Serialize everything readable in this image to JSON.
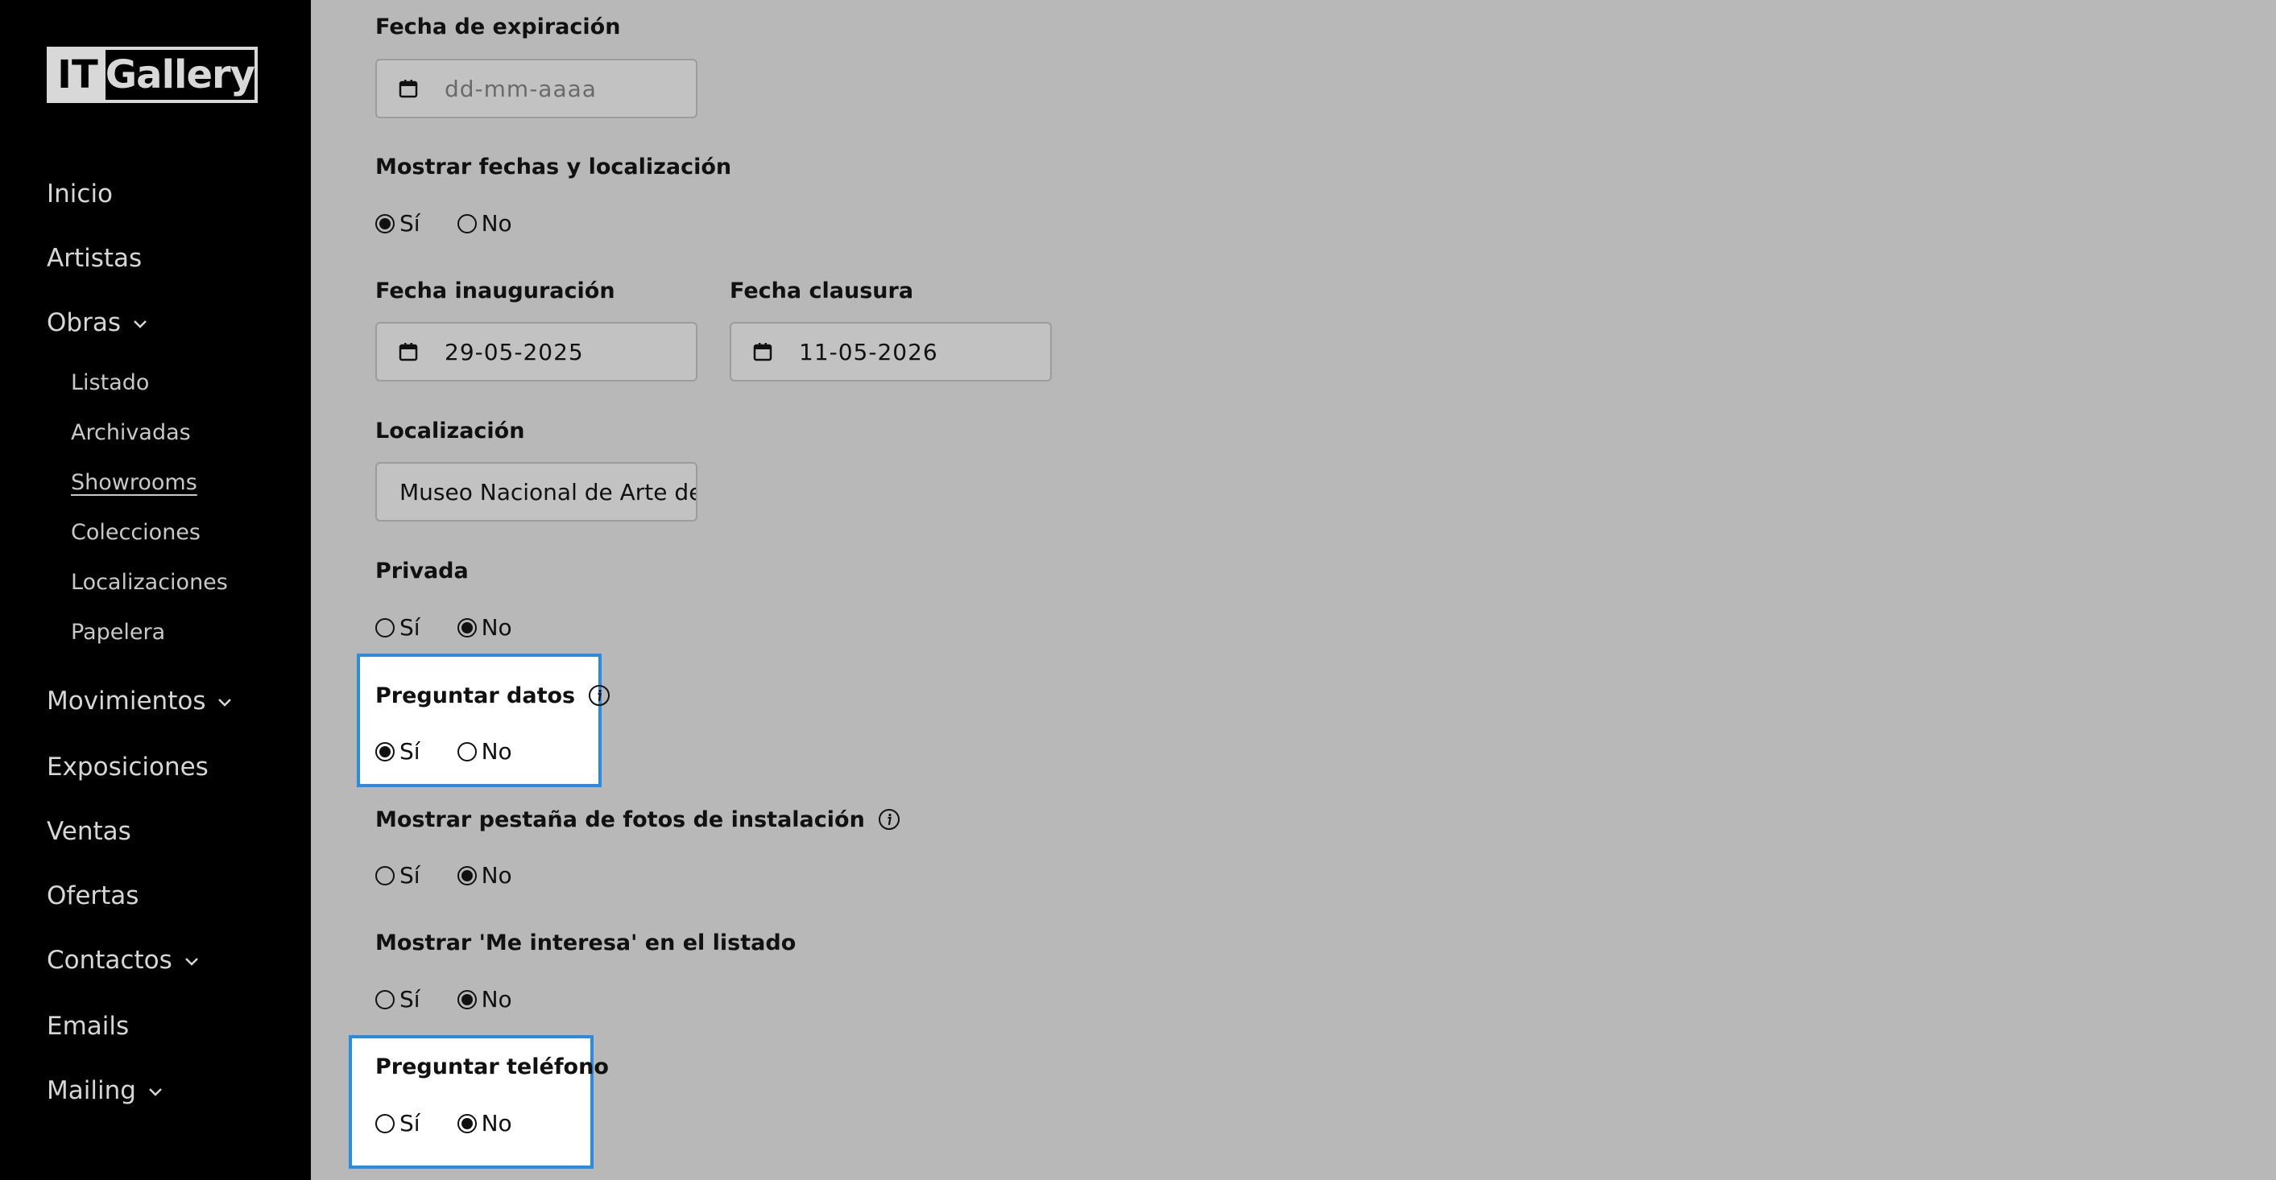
{
  "sidebar": {
    "logo": {
      "it": "IT",
      "gallery": "Gallery"
    },
    "items": [
      {
        "label": "Inicio"
      },
      {
        "label": "Artistas"
      },
      {
        "label": "Obras"
      },
      {
        "label": "Movimientos"
      },
      {
        "label": "Exposiciones"
      },
      {
        "label": "Ventas"
      },
      {
        "label": "Ofertas"
      },
      {
        "label": "Contactos"
      },
      {
        "label": "Emails"
      },
      {
        "label": "Mailing"
      }
    ],
    "obras_sub": [
      {
        "label": "Listado"
      },
      {
        "label": "Archivadas"
      },
      {
        "label": "Showrooms"
      },
      {
        "label": "Colecciones"
      },
      {
        "label": "Localizaciones"
      },
      {
        "label": "Papelera"
      }
    ]
  },
  "form": {
    "expiracion": {
      "label": "Fecha de expiración",
      "placeholder": "dd-mm-aaaa"
    },
    "mostrar_fechas": {
      "label": "Mostrar fechas y localización",
      "yes": "Sí",
      "no": "No",
      "selected": "yes"
    },
    "inauguracion": {
      "label": "Fecha inauguración",
      "value": "29-05-2025"
    },
    "clausura": {
      "label": "Fecha clausura",
      "value": "11-05-2026"
    },
    "localizacion": {
      "label": "Localización",
      "value": "Museo Nacional de Arte de"
    },
    "privada": {
      "label": "Privada",
      "yes": "Sí",
      "no": "No",
      "selected": "no"
    },
    "preguntar_datos": {
      "label": "Preguntar datos",
      "yes": "Sí",
      "no": "No",
      "selected": "yes"
    },
    "fotos_instalacion": {
      "label": "Mostrar pestaña de fotos de instalación",
      "yes": "Sí",
      "no": "No",
      "selected": "no"
    },
    "me_interesa": {
      "label": "Mostrar 'Me interesa' en el listado",
      "yes": "Sí",
      "no": "No",
      "selected": "no"
    },
    "preguntar_telefono": {
      "label": "Preguntar teléfono",
      "yes": "Sí",
      "no": "No",
      "selected": "no"
    }
  },
  "colors": {
    "highlight": "#2a8be0",
    "sidebar_bg": "#000000",
    "main_bg": "#b8b8b8"
  }
}
